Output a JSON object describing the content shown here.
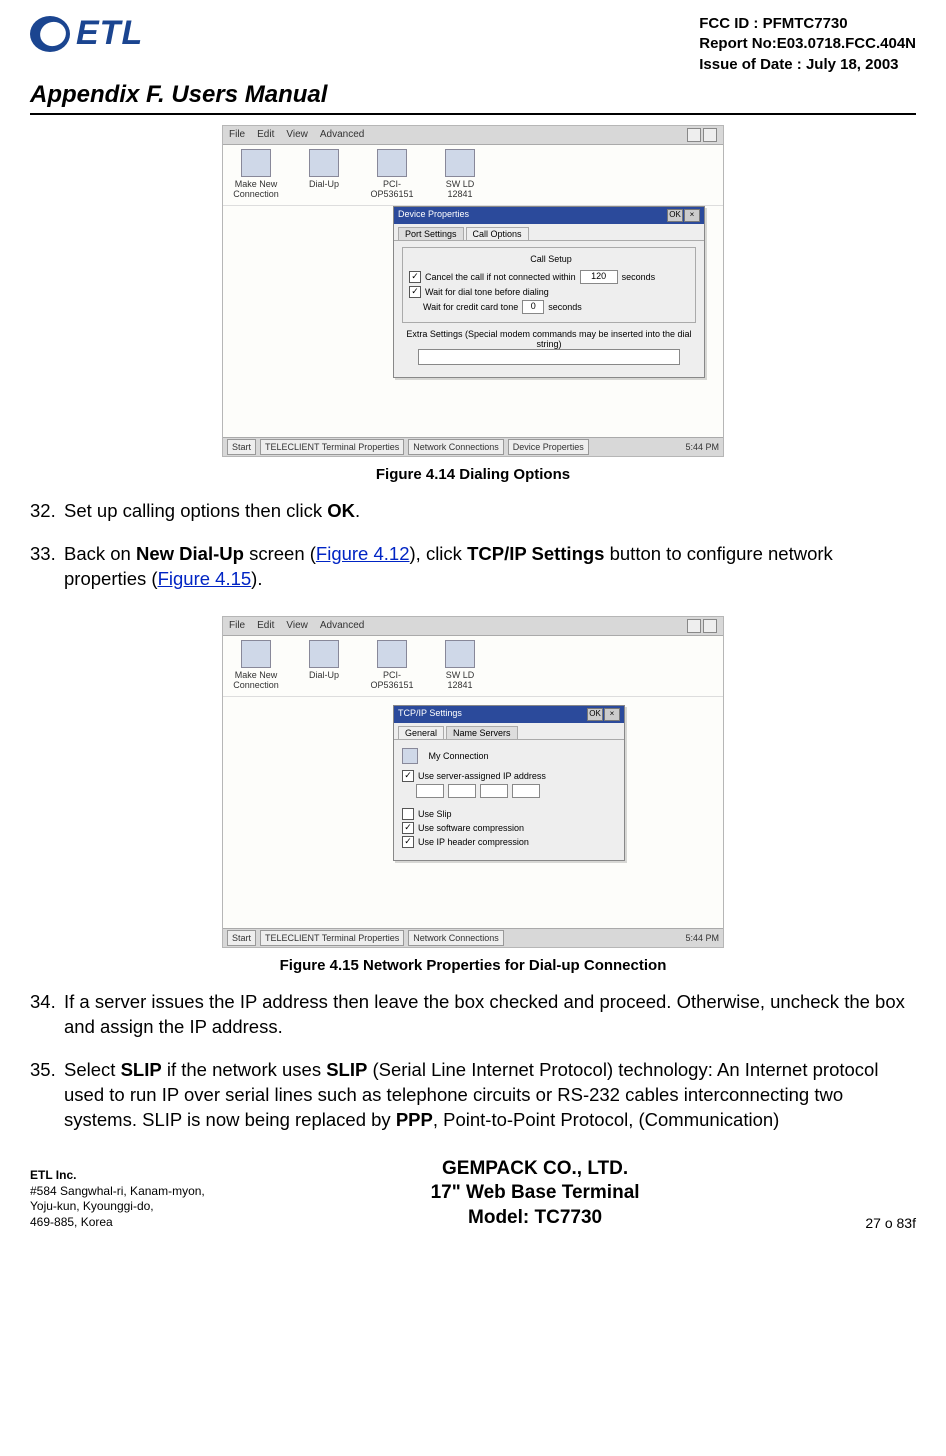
{
  "header": {
    "logo_text": "ETL",
    "fcc": "FCC ID : PFMTC7730",
    "report": "Report No:E03.0718.FCC.404N",
    "issue": "Issue of Date : July 18, 2003"
  },
  "appendix_title": "Appendix F.  Users Manual",
  "figure1": {
    "menubar": [
      "File",
      "Edit",
      "View",
      "Advanced"
    ],
    "icons": [
      {
        "label": "Make New Connection"
      },
      {
        "label": "Dial-Up"
      },
      {
        "label": "PCI-OP536151"
      },
      {
        "label": "SW LD 12841"
      }
    ],
    "dialog_title": "Device Properties",
    "ok": "OK",
    "x": "×",
    "tab1": "Port Settings",
    "tab2": "Call Options",
    "group_label": "Call Setup",
    "row1_a": "Cancel the call if not connected within",
    "row1_b": "120",
    "row1_c": "seconds",
    "row2": "Wait for dial tone before dialing",
    "row3_a": "Wait for credit card tone",
    "row3_b": "0",
    "row3_c": "seconds",
    "extra": "Extra Settings (Special modem commands may be inserted into the dial string)",
    "taskbar": [
      "Start",
      "TELECLIENT Terminal Properties",
      "Network Connections",
      "Device Properties"
    ],
    "time": "5:44 PM",
    "caption": "Figure 4.14       Dialing Options"
  },
  "step32": {
    "num": "32.",
    "t1": "Set up calling options then click ",
    "b": "OK",
    "t2": "."
  },
  "step33": {
    "num": "33.",
    "t1": "Back on ",
    "b1": "New Dial-Up",
    "t2": " screen (",
    "link1": "Figure 4.12",
    "t3": "), click ",
    "b2": "TCP/IP Settings",
    "t4": " button to configure network properties (",
    "link2": "Figure 4.15",
    "t5": ")."
  },
  "figure2": {
    "dialog_title": "TCP/IP Settings",
    "tab1": "General",
    "tab2": "Name Servers",
    "conn": "My Connection",
    "row1": "Use server-assigned IP address",
    "row2": "Use Slip",
    "row3": "Use software compression",
    "row4": "Use IP header compression",
    "taskbar": [
      "Start",
      "TELECLIENT Terminal Properties",
      "Network Connections"
    ],
    "time": "5:44 PM",
    "caption": "Figure 4.15       Network Properties for Dial-up Connection"
  },
  "step34": {
    "num": "34.",
    "text": "If a server issues the IP address then leave the box checked and proceed. Otherwise, uncheck the box and assign the IP address."
  },
  "step35": {
    "num": "35.",
    "t1": "Select ",
    "b1": "SLIP",
    "t2": " if the network uses ",
    "b2": "SLIP",
    "t3": " (Serial Line Internet Protocol) technology:  An Internet protocol used to run IP over serial lines such as telephone circuits or RS-232 cables interconnecting two systems. SLIP is now being replaced by ",
    "b3": "PPP",
    "t4": ", Point-to-Point Protocol, (Communication)"
  },
  "footer": {
    "company": "ETL Inc.",
    "addr1": "#584 Sangwhal-ri, Kanam-myon,",
    "addr2": "Yoju-kun, Kyounggi-do,",
    "addr3": "469-885, Korea",
    "c1": "GEMPACK CO., LTD.",
    "c2": "17\" Web Base Terminal",
    "c3": "Model: TC7730",
    "page": "27 o 83f"
  }
}
